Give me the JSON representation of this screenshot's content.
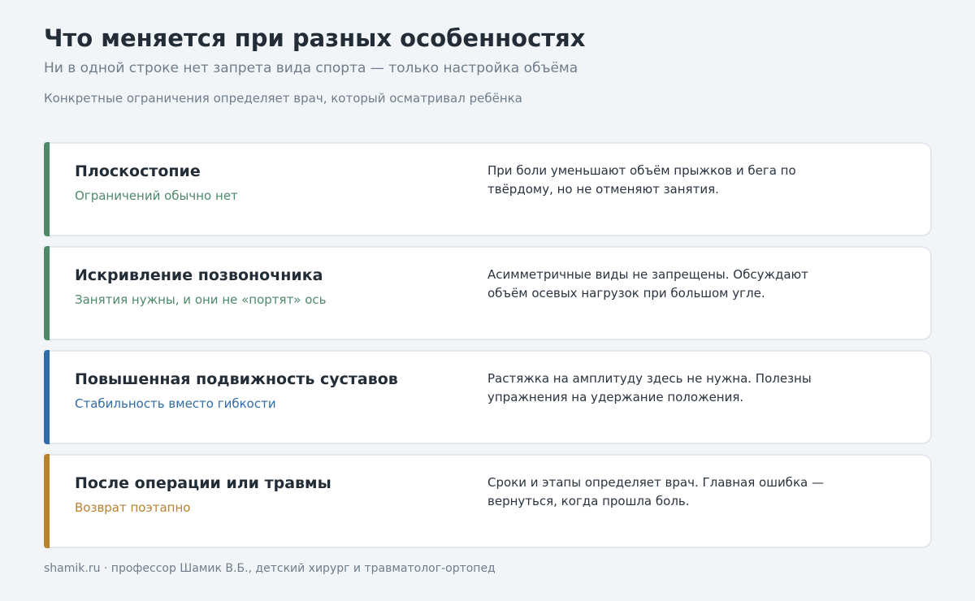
{
  "header": {
    "title": "Что меняется при разных особенностях",
    "subtitle": "Ни в одной строке нет запрета вида спорта — только настройка объёма",
    "note": "Конкретные ограничения определяет врач, который осматривал ребёнка"
  },
  "cards": [
    {
      "title": "Плоскостопие",
      "tag": "Ограничений обычно нет",
      "description": "При боли уменьшают объём прыжков и бега по твёрдому, но не отменяют занятия.",
      "accent_color": "#4e8a6a"
    },
    {
      "title": "Искривление позвоночника",
      "tag": "Занятия нужны, и они не «портят» ось",
      "description": "Асимметричные виды не запрещены. Обсуждают объём осевых нагрузок при большом угле.",
      "accent_color": "#4e8a6a"
    },
    {
      "title": "Повышенная подвижность суставов",
      "tag": "Стабильность вместо гибкости",
      "description": "Растяжка на амплитуду здесь не нужна. Полезны упражнения на удержание положения.",
      "accent_color": "#2f6ca8"
    },
    {
      "title": "После операции или травмы",
      "tag": "Возврат поэтапно",
      "description": "Сроки и этапы определяет врач. Главная ошибка — вернуться, когда прошла боль.",
      "accent_color": "#b8822f"
    }
  ],
  "footer": {
    "text": "shamik.ru · профессор Шамик В.Б., детский хирург и травматолог-ортопед"
  }
}
